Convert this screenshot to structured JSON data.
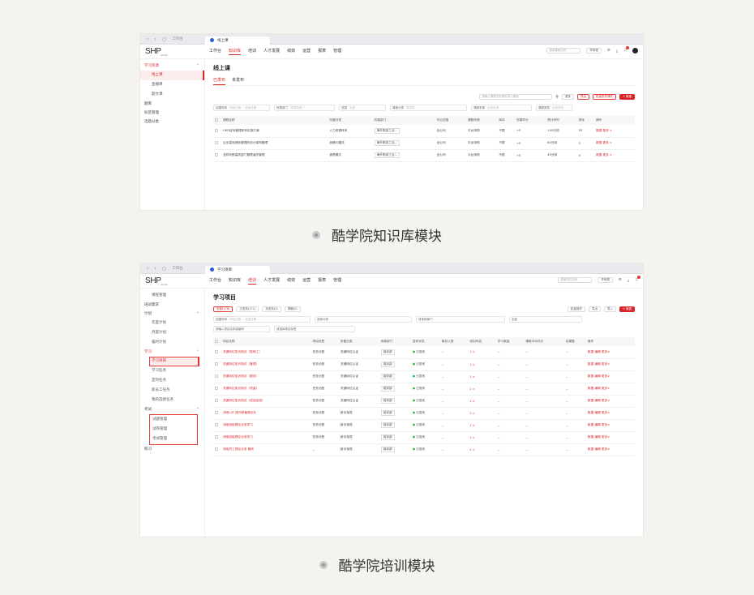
{
  "shot1": {
    "browser": {
      "workspace": "工作台",
      "tab_label": "线上课"
    },
    "logo": "SHP",
    "logo_sub": "ELITE+",
    "top_nav": [
      "工作台",
      "知识库",
      "培训",
      "人才发展",
      "绩效",
      "运营",
      "报表",
      "管理"
    ],
    "top_nav_active": 1,
    "search_placeholder": "搜索课程名称",
    "user_pill": "李明德",
    "sidebar": {
      "group": "学习资源",
      "items": [
        "线上课",
        "直播课",
        "题文课"
      ],
      "others": [
        "题库",
        "标签管理",
        "话题分类"
      ]
    },
    "page_title": "线上课",
    "sub_tabs": [
      "已发布",
      "未发布"
    ],
    "actions": {
      "search_placeholder": "请输入课程名称或负责人搜索",
      "btn_more": "更多",
      "btn_export": "导出",
      "btn_batch": "批量发布课件",
      "btn_new": "+ 新建"
    },
    "filters": [
      {
        "label": "创建时间",
        "ph": "开始日期 ~ 结束日期"
      },
      {
        "label": "所属部门",
        "ph": "请选择部门"
      },
      {
        "label": "范围",
        "ph": "全部"
      },
      {
        "label": "课程分类",
        "ph": "请选择"
      },
      {
        "label": "课程来源",
        "ph": "全部来源"
      },
      {
        "label": "课程类型",
        "ph": "全部类型"
      }
    ],
    "columns": [
      "课程名称",
      "所属分类",
      "所属部门",
      "可见范围",
      "课程来源",
      "库存",
      "完课学分",
      "预计学时",
      "排序",
      "操作"
    ],
    "rows": [
      [
        "OKR目标管理体系实施方案",
        "人力资源体系",
        "海外物流工业...",
        "全公司",
        "平台采购",
        "不限",
        "+5",
        "145分钟",
        "55",
        "数据  更多 ∨"
      ],
      [
        "企业高效绩效管理的设计架构管理",
        "战略与模式",
        "海外物流工业...",
        "全公司",
        "平台采购",
        "不限",
        "+5",
        "80分钟",
        "3",
        "数据  更多 ∨"
      ],
      [
        "怎样判断高质部门管理者的管理",
        "销售模式",
        "海外物流工业...",
        "全公司",
        "平台采购",
        "不限",
        "+5",
        "45分钟",
        "4",
        "数据  更多 ∨"
      ]
    ]
  },
  "caption1": "酷学院知识库模块",
  "shot2": {
    "browser": {
      "workspace": "工作台",
      "tab_label": "学习项目"
    },
    "logo": "SHP",
    "logo_sub": "ELITE+",
    "top_nav": [
      "工作台",
      "知识库",
      "培训",
      "人才发展",
      "绩效",
      "运营",
      "报表",
      "管理"
    ],
    "top_nav_active": 2,
    "search_placeholder": "搜索项目名称",
    "user_pill": "李明德",
    "sidebar": {
      "pre": [
        "课程管理",
        "培训需求"
      ],
      "plan_group": "计划",
      "plan_items": [
        "年度计划",
        "月度计划",
        "临时计划"
      ],
      "learn_group": "学习",
      "learn_items": [
        "学习项目",
        "学习任务",
        "定时任务",
        "新员工任务",
        "我的选修任务"
      ],
      "exam_group": "考试",
      "exam_items": [
        "试题管理",
        "试卷管理",
        "考试管理"
      ],
      "last_group": "练习"
    },
    "page_title": "学习项目",
    "sub_tabs": [
      "全部(176)",
      "已发布(171)",
      "未发布(5)",
      "草稿(0)"
    ],
    "actions": {
      "btn_batch": "批量操作",
      "btn_export": "导出",
      "btn_import": "导入",
      "btn_new": "+ 新建"
    },
    "filters": [
      {
        "label": "创建时间",
        "ph": "开始日期 ~ 结束日期"
      },
      {
        "label": "选择分类",
        "ph": ""
      },
      {
        "label": "请选择部门",
        "ph": ""
      },
      {
        "label": "全部",
        "ph": ""
      },
      {
        "label": "请输入项目名称或编号",
        "ph": ""
      },
      {
        "label": "请选择项目标签",
        "ph": ""
      }
    ],
    "columns": [
      "项目名称",
      "项目标签",
      "所属分类",
      "所属部门",
      "发布状态",
      "报名人数",
      "培训内容",
      "学习数量",
      "课程平均评分",
      "结果数",
      "操作"
    ],
    "rows": [
      [
        "关键岗位知识测试（现场工）",
        "任务分配",
        "关键岗位认证",
        "培训部",
        "已发布",
        "--",
        "1 >",
        "--",
        "--",
        "--",
        "数据  编辑  更多∨"
      ],
      [
        "关键岗位知识测试（管理）",
        "任务分配",
        "关键岗位认证",
        "培训部",
        "已发布",
        "--",
        "1 >",
        "--",
        "--",
        "--",
        "数据  编辑  更多∨"
      ],
      [
        "关键岗位知识测试（服务）",
        "任务分配",
        "关键岗位认证",
        "培训部",
        "已发布",
        "--",
        "1 >",
        "--",
        "--",
        "--",
        "数据  编辑  更多∨"
      ],
      [
        "关键岗位知识测试（质量）",
        "任务分配",
        "关键岗位认证",
        "培训部",
        "已发布",
        "--",
        "1 >",
        "--",
        "--",
        "--",
        "数据  编辑  更多∨"
      ],
      [
        "关键岗位知识测试（成品检验）",
        "任务分配",
        "关键岗位认证",
        "培训部",
        "已发布",
        "--",
        "1 >",
        "--",
        "--",
        "--",
        "数据  编辑  更多∨"
      ],
      [
        "领用LAT 提升和管理业务",
        "任务分配",
        "新手指导",
        "培训部",
        "已发布",
        "--",
        "2 >",
        "--",
        "--",
        "--",
        "数据  编辑  更多∨"
      ],
      [
        "领用班组理论业务学习",
        "任务分配",
        "新手指导",
        "培训部",
        "已发布",
        "--",
        "1 >",
        "--",
        "--",
        "--",
        "数据  编辑  更多∨"
      ],
      [
        "领用班组理论业务学习",
        "任务分配",
        "新手指导",
        "培训部",
        "已发布",
        "--",
        "2 >",
        "--",
        "--",
        "--",
        "数据  编辑  更多∨"
      ],
      [
        "领用员工理论业务 模块",
        "--",
        "新手指导",
        "培训部",
        "已发布",
        "--",
        "2 >",
        "--",
        "--",
        "--",
        "数据  编辑  更多∨"
      ]
    ]
  },
  "caption2": "酷学院培训模块"
}
